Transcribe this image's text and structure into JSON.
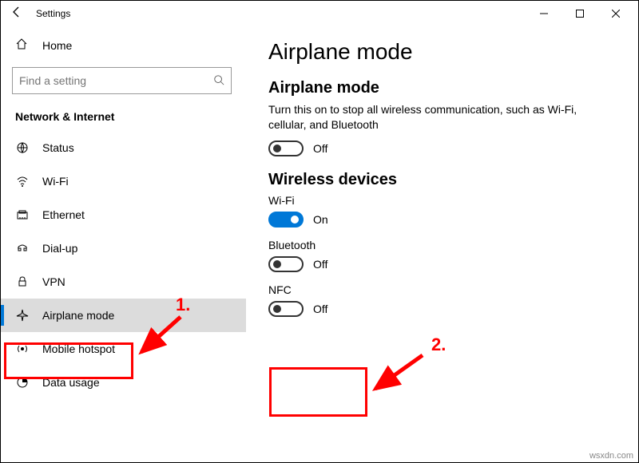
{
  "window": {
    "title": "Settings"
  },
  "sidebar": {
    "home": "Home",
    "search_placeholder": "Find a setting",
    "category": "Network & Internet",
    "items": [
      {
        "label": "Status"
      },
      {
        "label": "Wi-Fi"
      },
      {
        "label": "Ethernet"
      },
      {
        "label": "Dial-up"
      },
      {
        "label": "VPN"
      },
      {
        "label": "Airplane mode"
      },
      {
        "label": "Mobile hotspot"
      },
      {
        "label": "Data usage"
      }
    ]
  },
  "page": {
    "title": "Airplane mode",
    "airplane": {
      "heading": "Airplane mode",
      "desc": "Turn this on to stop all wireless communication, such as Wi-Fi, cellular, and Bluetooth",
      "state": "Off"
    },
    "wireless": {
      "heading": "Wireless devices",
      "wifi_label": "Wi-Fi",
      "wifi_state": "On",
      "bt_label": "Bluetooth",
      "bt_state": "Off",
      "nfc_label": "NFC",
      "nfc_state": "Off"
    }
  },
  "annotations": {
    "label1": "1.",
    "label2": "2."
  },
  "watermark": "wsxdn.com"
}
